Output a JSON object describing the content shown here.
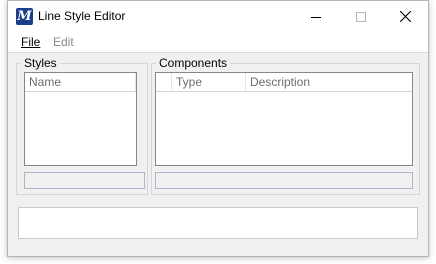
{
  "window": {
    "title": "Line Style Editor",
    "app_icon": "microstation-m-icon"
  },
  "titlebar_buttons": {
    "minimize": "minimize-icon",
    "maximize": "maximize-icon",
    "close": "close-icon"
  },
  "menu": {
    "file": "File",
    "edit": "Edit"
  },
  "styles_panel": {
    "label": "Styles",
    "columns": [
      "Name"
    ],
    "rows": [],
    "name_field_value": ""
  },
  "components_panel": {
    "label": "Components",
    "columns": [
      "",
      "Type",
      "Description"
    ],
    "rows": [],
    "description_field_value": ""
  },
  "status_area": {
    "text": ""
  },
  "colors": {
    "window_bg": "#f0f0f0",
    "icon_blue": "#1a3e8a"
  }
}
